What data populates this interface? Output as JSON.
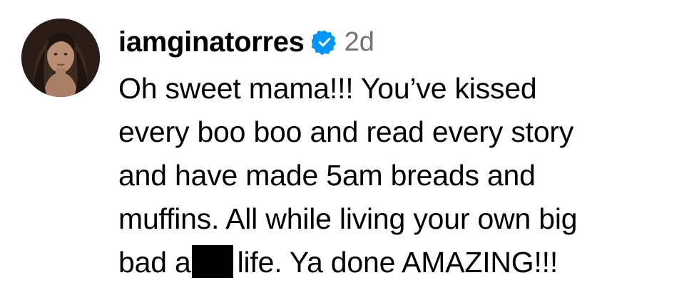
{
  "comment": {
    "author": {
      "username": "iamginatorres",
      "verified": true,
      "avatar_icon": "profile-photo"
    },
    "timestamp": "2d",
    "lines": [
      "Oh sweet mama!!! You’ve kissed",
      "every boo boo and read every story",
      "and have made 5am breads and",
      "muffins. All while living your own big"
    ],
    "last_line": {
      "before_redaction": "bad a",
      "after_redaction": "life. Ya done AMAZING!!!"
    }
  },
  "colors": {
    "text": "#000000",
    "timestamp": "#737373",
    "verified_badge": "#0095f6",
    "redaction": "#000000",
    "background": "#ffffff"
  }
}
